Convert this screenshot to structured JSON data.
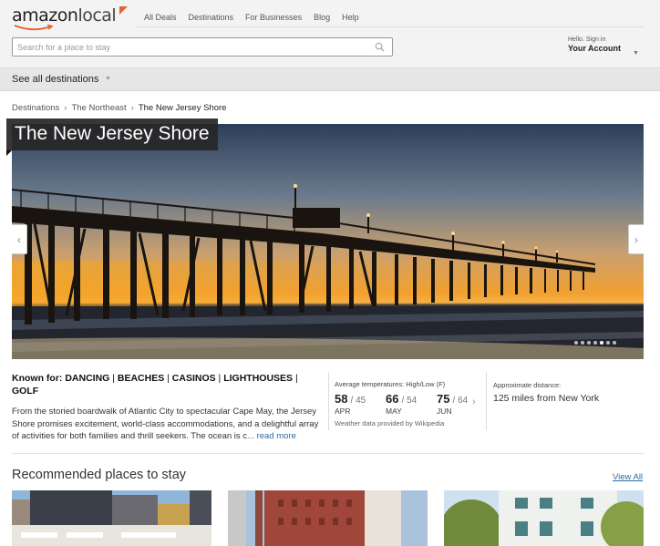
{
  "header": {
    "logo_text_bold": "amazon",
    "logo_text_light": "local",
    "nav": [
      "All Deals",
      "Destinations",
      "For Businesses",
      "Blog",
      "Help"
    ],
    "search_placeholder": "Search for a place to stay",
    "account_hello": "Hello. Sign in",
    "account_label": "Your Account"
  },
  "destbar": {
    "label": "See all destinations"
  },
  "breadcrumb": [
    "Destinations",
    "The Northeast",
    "The New Jersey Shore"
  ],
  "hero": {
    "title": "The New Jersey Shore",
    "slide_count": 7,
    "active_slide": 5
  },
  "info": {
    "known_for_label": "Known for:",
    "known_for": [
      "DANCING",
      "BEACHES",
      "CASINOS",
      "LIGHTHOUSES",
      "GOLF"
    ],
    "description": "From the storied boardwalk of Atlantic City to spectacular Cape May, the Jersey Shore promises excitement, world-class accommodations, and a delightful array of activities for both families and thrill seekers. The ocean is c",
    "read_more": "... read more",
    "temps_label": "Average temperatures: High/Low (F)",
    "temps": [
      {
        "high": "58",
        "low": "/ 45",
        "month": "APR"
      },
      {
        "high": "66",
        "low": "/ 54",
        "month": "MAY"
      },
      {
        "high": "75",
        "low": "/ 64",
        "month": "JUN"
      }
    ],
    "weather_note": "Weather data provided by Wikipedia",
    "distance_label": "Approximate distance:",
    "distance": "125 miles from New York"
  },
  "recommended": {
    "title": "Recommended places to stay",
    "view_all": "View All"
  },
  "colors": {
    "link": "#2a6ba5",
    "logo_accent": "#e8622a"
  },
  "icons": [
    "search-icon",
    "chevron-down-icon",
    "chevron-left-icon",
    "chevron-right-icon"
  ]
}
